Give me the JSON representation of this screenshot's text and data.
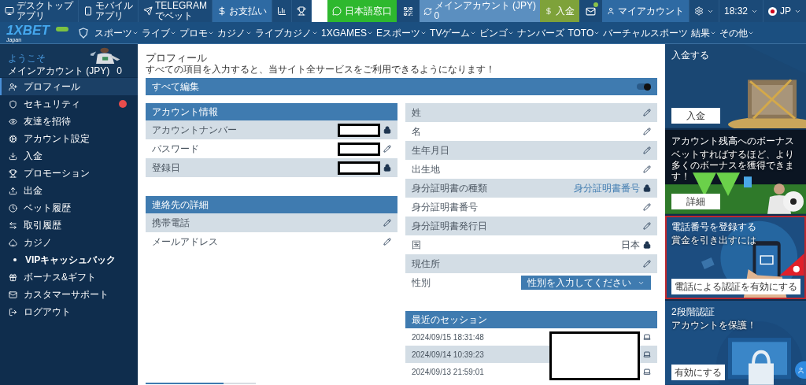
{
  "top_bar": {
    "left": [
      {
        "kind": "desktop",
        "lines": [
          "デスクトップ",
          "アプリ"
        ]
      },
      {
        "kind": "mobile",
        "lines": [
          "モバイル",
          "アプリ"
        ]
      },
      {
        "kind": "telegram",
        "lines": [
          "TELEGRAM",
          "でベット"
        ]
      },
      {
        "kind": "payment",
        "lines": [
          "お支払い"
        ]
      },
      {
        "kind": "stats"
      },
      {
        "kind": "trophy"
      }
    ],
    "support": {
      "label": "日本語窓口"
    },
    "account": {
      "name": "メインアカウント (JPY)",
      "balance": "0"
    },
    "deposit": {
      "label": "入金"
    },
    "mail": {
      "unread": true
    },
    "my_account": {
      "label": "マイアカウント"
    },
    "time": "18:32",
    "language": "JP"
  },
  "logo": {
    "text": "1XBET",
    "region": "Japan"
  },
  "nav": [
    {
      "label": "スポーツ",
      "has_menu": true
    },
    {
      "label": "ライブ",
      "has_menu": true
    },
    {
      "label": "プロモ",
      "has_menu": true
    },
    {
      "label": "カジノ",
      "has_menu": true
    },
    {
      "label": "ライブカジノ",
      "has_menu": true
    },
    {
      "label": "1XGAMES",
      "has_menu": true
    },
    {
      "label": "Eスポーツ",
      "has_menu": true
    },
    {
      "label": "TVゲーム",
      "has_menu": true
    },
    {
      "label": "ビンゴ",
      "has_menu": true
    },
    {
      "label": "ナンバーズ",
      "has_menu": false
    },
    {
      "label": "TOTO",
      "has_menu": true
    },
    {
      "label": "バーチャルスポーツ",
      "has_menu": false
    },
    {
      "label": "結果",
      "has_menu": true
    },
    {
      "label": "その他",
      "has_menu": true
    }
  ],
  "sidebar": {
    "welcome": "ようこそ",
    "account": "メインアカウント (JPY)",
    "balance": "0",
    "items": [
      {
        "kind": "profile",
        "label": "プロフィール",
        "selected": true,
        "alert": false
      },
      {
        "kind": "security",
        "label": "セキュリティ",
        "selected": false,
        "alert": true
      },
      {
        "kind": "invite",
        "label": "友達を招待",
        "selected": false,
        "alert": false
      },
      {
        "kind": "settings",
        "label": "アカウント設定",
        "selected": false,
        "alert": false
      },
      {
        "kind": "deposit",
        "label": "入金",
        "selected": false,
        "alert": false
      },
      {
        "kind": "promo",
        "label": "プロモーション",
        "selected": false,
        "alert": false
      },
      {
        "kind": "withdraw",
        "label": "出金",
        "selected": false,
        "alert": false
      },
      {
        "kind": "history",
        "label": "ベット履歴",
        "selected": false,
        "alert": false
      },
      {
        "kind": "transfer",
        "label": "取引履歴",
        "selected": false,
        "alert": false
      },
      {
        "kind": "casino",
        "label": "カジノ",
        "selected": false,
        "alert": false,
        "children": [
          {
            "label": "VIPキャッシュバック",
            "selected": false,
            "alert": false
          }
        ]
      },
      {
        "kind": "gift",
        "label": "ボーナス&ギフト",
        "selected": false,
        "alert": false
      },
      {
        "kind": "support",
        "label": "カスタマーサポート",
        "selected": false,
        "alert": false
      },
      {
        "kind": "logout",
        "label": "ログアウト",
        "selected": false,
        "alert": false
      }
    ]
  },
  "profile": {
    "title": "プロフィール",
    "subtitle": "すべての項目を入力すると、当サイト全サービスをご利用できるようになります！",
    "edit_all": {
      "label": "すべて編集",
      "on": true
    },
    "account_info": {
      "title": "アカウント情報",
      "rows": [
        {
          "label": "アカウントナンバー",
          "locked": true,
          "redacted": true
        },
        {
          "label": "パスワード",
          "locked": false,
          "redacted": true
        },
        {
          "label": "登録日",
          "locked": true,
          "redacted": true
        }
      ]
    },
    "contact": {
      "title": "連絡先の詳細",
      "rows": [
        {
          "label": "携帯電話",
          "locked": false,
          "redacted": false
        },
        {
          "label": "メールアドレス",
          "locked": false,
          "redacted": false
        }
      ]
    },
    "personal": [
      {
        "kind": "field",
        "label": "姓",
        "locked": false
      },
      {
        "kind": "field",
        "label": "名",
        "locked": false
      },
      {
        "kind": "field",
        "label": "生年月日",
        "locked": false
      },
      {
        "kind": "field",
        "label": "出生地",
        "locked": false
      },
      {
        "kind": "field",
        "label": "身分証明書の種類",
        "value": "身分証明書番号",
        "locked": true
      },
      {
        "kind": "field",
        "label": "身分証明書番号",
        "locked": false
      },
      {
        "kind": "field",
        "label": "身分証明書発行日",
        "locked": false
      },
      {
        "kind": "field",
        "label": "国",
        "value": "日本",
        "locked": true
      },
      {
        "kind": "field",
        "label": "現住所",
        "locked": false
      },
      {
        "kind": "select",
        "label": "性別",
        "placeholder": "性別を入力してください"
      }
    ],
    "sessions": {
      "title": "最近のセッション",
      "redacted": true,
      "rows": [
        {
          "time": "2024/09/15 18:31:48"
        },
        {
          "time": "2024/09/14 10:39:23"
        },
        {
          "time": "2024/09/13 21:59:01"
        }
      ]
    },
    "progress": {
      "level": 0.71
    }
  },
  "promos": [
    {
      "kind": "deposit",
      "title": "入金する",
      "button": "入金",
      "highlighted": false
    },
    {
      "kind": "bonus",
      "title": "アカウント残高へのボーナス",
      "subtitle": "ベットすればするほど、より多くのボーナスを獲得できます！",
      "button": "詳細",
      "highlighted": false
    },
    {
      "kind": "phone",
      "title": "電話番号を登録する",
      "subtitle": "賞金を引き出すには",
      "button": "電話による認証を有効にする",
      "highlighted": true
    },
    {
      "kind": "two_factor",
      "title": "2段階認証",
      "subtitle": "アカウントを保護！",
      "button": "有効にする",
      "highlighted": false
    }
  ]
}
